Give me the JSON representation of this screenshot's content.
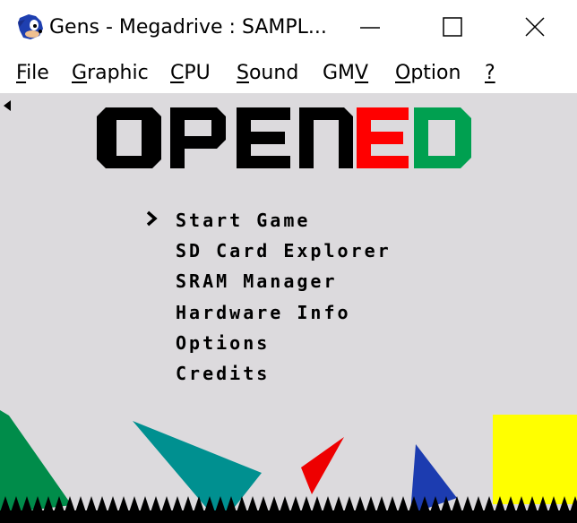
{
  "window": {
    "title": "Gens - Megadrive : SAMPL...",
    "app_icon": "sonic-hedgehog-icon",
    "controls": [
      "minimize-icon",
      "maximize-icon",
      "close-icon"
    ]
  },
  "menubar": {
    "items": [
      {
        "label": "File",
        "mnemonic": "F",
        "rest": "ile"
      },
      {
        "label": "Graphic",
        "mnemonic": "G",
        "rest": "raphic"
      },
      {
        "label": "CPU",
        "mnemonic": "C",
        "rest": "PU"
      },
      {
        "label": "Sound",
        "mnemonic": "S",
        "rest": "ound"
      },
      {
        "label": "GMV",
        "pre": "GM",
        "mnemonic": "V"
      },
      {
        "label": "Option",
        "mnemonic": "O",
        "rest": "ption"
      },
      {
        "label": "?",
        "mnemonic": "?",
        "rest": ""
      }
    ]
  },
  "game": {
    "logo": {
      "part1": "OPEN",
      "part2": "ED"
    },
    "colors": {
      "background": "#dcdadd",
      "logo_black": "#000000",
      "logo_red": "#ff0000",
      "logo_green": "#00a050"
    },
    "selected_index": 0,
    "entries": [
      "Start Game",
      "SD Card Explorer",
      "SRAM Manager",
      "Hardware Info",
      "Options",
      "Credits"
    ]
  }
}
